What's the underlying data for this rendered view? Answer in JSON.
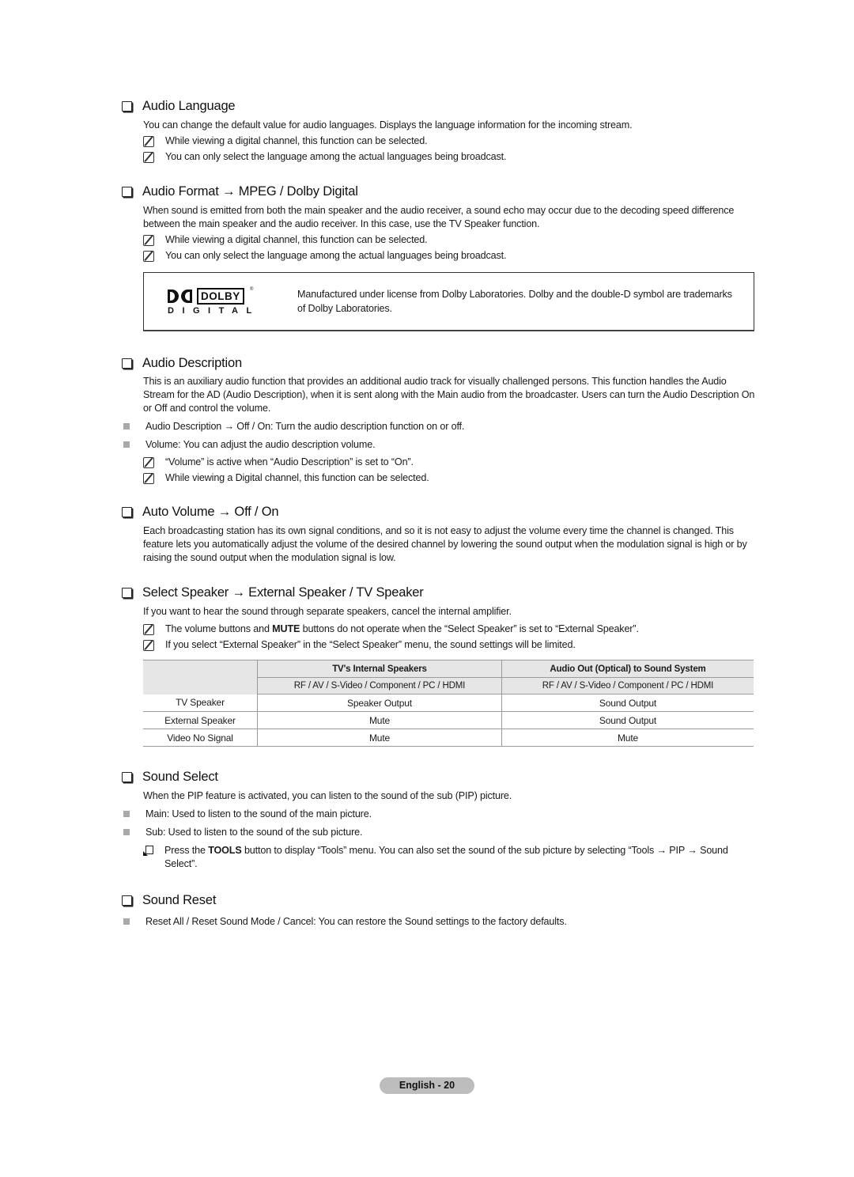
{
  "sections": {
    "audio_language": {
      "title": "Audio Language",
      "body": "You can change the default value for audio languages. Displays the language information for the incoming stream.",
      "notes": [
        "While viewing a digital channel, this function can be selected.",
        "You can only select the language among the actual languages being broadcast."
      ]
    },
    "audio_format": {
      "title": "Audio Format → MPEG / Dolby Digital",
      "body": "When sound is emitted from both the main speaker and the audio receiver, a sound echo may occur due to the decoding speed difference between the main speaker and the audio receiver. In this case, use the TV Speaker function.",
      "notes": [
        "While viewing a digital channel, this function can be selected.",
        "You can only select the language among the actual languages being broadcast."
      ],
      "dolby": {
        "logo_word": "DOLBY",
        "logo_sub": "DIGITAL",
        "logo_reg": "®",
        "text": "Manufactured under license from Dolby Laboratories. Dolby and the double-D symbol are trademarks of Dolby Laboratories."
      }
    },
    "audio_description": {
      "title": "Audio Description",
      "body": "This is an auxiliary audio function that provides an additional audio track for visually challenged persons. This function handles the Audio Stream for the AD (Audio Description), when it is sent along with the Main audio from the broadcaster. Users can turn the Audio Description On or Off and control the volume.",
      "bullets": [
        "Audio Description → Off / On: Turn the audio description function on or off.",
        "Volume: You can adjust the audio description volume."
      ],
      "notes": [
        "“Volume” is active when “Audio Description” is set to “On”.",
        "While viewing a Digital channel, this function can be selected."
      ]
    },
    "auto_volume": {
      "title": "Auto Volume → Off / On",
      "body": "Each broadcasting station has its own signal conditions, and so it is not easy to adjust the volume every time the channel is changed. This feature lets you automatically adjust the volume of the desired channel by lowering the sound output when the modulation signal is high or by raising the sound output when the modulation signal is low."
    },
    "select_speaker": {
      "title": "Select Speaker → External Speaker / TV Speaker",
      "body": "If you want to hear the sound through separate speakers, cancel the internal amplifier.",
      "note1_pre": "The volume buttons and ",
      "note1_bold": "MUTE",
      "note1_post": " buttons do not operate when the “Select Speaker” is set to “External Speaker”.",
      "note2": "If you select “External Speaker” in the “Select Speaker” menu, the sound settings will be limited.",
      "table": {
        "headers": [
          "",
          "TV's Internal Speakers",
          "Audio Out (Optical) to Sound System"
        ],
        "subheaders": [
          "",
          "RF / AV / S-Video / Component / PC / HDMI",
          "RF / AV / S-Video / Component / PC / HDMI"
        ],
        "rows": [
          [
            "TV Speaker",
            "Speaker Output",
            "Sound Output"
          ],
          [
            "External Speaker",
            "Mute",
            "Sound Output"
          ],
          [
            "Video No Signal",
            "Mute",
            "Mute"
          ]
        ]
      }
    },
    "sound_select": {
      "title": "Sound Select",
      "body": "When the PIP feature is activated, you can listen to the sound of the sub (PIP) picture.",
      "bullets": [
        "Main: Used to listen to the sound of the main picture.",
        "Sub: Used to listen to the sound of the sub picture."
      ],
      "tool_pre": "Press the ",
      "tool_bold": "TOOLS",
      "tool_post": " button to display “Tools” menu. You can also set the sound of the sub picture by selecting “Tools → PIP → Sound Select”."
    },
    "sound_reset": {
      "title": "Sound Reset",
      "bullets": [
        "Reset All / Reset Sound Mode / Cancel: You can restore the Sound settings to the factory defaults."
      ]
    }
  },
  "footer": {
    "page_label": "English - 20"
  },
  "colors": {
    "bullet_gray": "#a9a9a9",
    "table_header_bg": "#e6e6e6",
    "footer_pill": "#bdbdbd"
  }
}
